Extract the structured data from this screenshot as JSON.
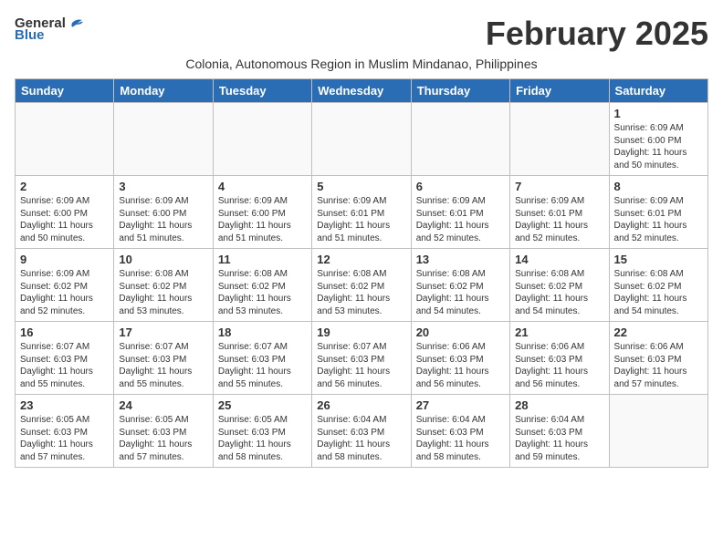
{
  "logo": {
    "general": "General",
    "blue": "Blue"
  },
  "title": "February 2025",
  "subtitle": "Colonia, Autonomous Region in Muslim Mindanao, Philippines",
  "weekdays": [
    "Sunday",
    "Monday",
    "Tuesday",
    "Wednesday",
    "Thursday",
    "Friday",
    "Saturday"
  ],
  "weeks": [
    [
      {
        "day": "",
        "info": ""
      },
      {
        "day": "",
        "info": ""
      },
      {
        "day": "",
        "info": ""
      },
      {
        "day": "",
        "info": ""
      },
      {
        "day": "",
        "info": ""
      },
      {
        "day": "",
        "info": ""
      },
      {
        "day": "1",
        "info": "Sunrise: 6:09 AM\nSunset: 6:00 PM\nDaylight: 11 hours\nand 50 minutes."
      }
    ],
    [
      {
        "day": "2",
        "info": "Sunrise: 6:09 AM\nSunset: 6:00 PM\nDaylight: 11 hours\nand 50 minutes."
      },
      {
        "day": "3",
        "info": "Sunrise: 6:09 AM\nSunset: 6:00 PM\nDaylight: 11 hours\nand 51 minutes."
      },
      {
        "day": "4",
        "info": "Sunrise: 6:09 AM\nSunset: 6:00 PM\nDaylight: 11 hours\nand 51 minutes."
      },
      {
        "day": "5",
        "info": "Sunrise: 6:09 AM\nSunset: 6:01 PM\nDaylight: 11 hours\nand 51 minutes."
      },
      {
        "day": "6",
        "info": "Sunrise: 6:09 AM\nSunset: 6:01 PM\nDaylight: 11 hours\nand 52 minutes."
      },
      {
        "day": "7",
        "info": "Sunrise: 6:09 AM\nSunset: 6:01 PM\nDaylight: 11 hours\nand 52 minutes."
      },
      {
        "day": "8",
        "info": "Sunrise: 6:09 AM\nSunset: 6:01 PM\nDaylight: 11 hours\nand 52 minutes."
      }
    ],
    [
      {
        "day": "9",
        "info": "Sunrise: 6:09 AM\nSunset: 6:02 PM\nDaylight: 11 hours\nand 52 minutes."
      },
      {
        "day": "10",
        "info": "Sunrise: 6:08 AM\nSunset: 6:02 PM\nDaylight: 11 hours\nand 53 minutes."
      },
      {
        "day": "11",
        "info": "Sunrise: 6:08 AM\nSunset: 6:02 PM\nDaylight: 11 hours\nand 53 minutes."
      },
      {
        "day": "12",
        "info": "Sunrise: 6:08 AM\nSunset: 6:02 PM\nDaylight: 11 hours\nand 53 minutes."
      },
      {
        "day": "13",
        "info": "Sunrise: 6:08 AM\nSunset: 6:02 PM\nDaylight: 11 hours\nand 54 minutes."
      },
      {
        "day": "14",
        "info": "Sunrise: 6:08 AM\nSunset: 6:02 PM\nDaylight: 11 hours\nand 54 minutes."
      },
      {
        "day": "15",
        "info": "Sunrise: 6:08 AM\nSunset: 6:02 PM\nDaylight: 11 hours\nand 54 minutes."
      }
    ],
    [
      {
        "day": "16",
        "info": "Sunrise: 6:07 AM\nSunset: 6:03 PM\nDaylight: 11 hours\nand 55 minutes."
      },
      {
        "day": "17",
        "info": "Sunrise: 6:07 AM\nSunset: 6:03 PM\nDaylight: 11 hours\nand 55 minutes."
      },
      {
        "day": "18",
        "info": "Sunrise: 6:07 AM\nSunset: 6:03 PM\nDaylight: 11 hours\nand 55 minutes."
      },
      {
        "day": "19",
        "info": "Sunrise: 6:07 AM\nSunset: 6:03 PM\nDaylight: 11 hours\nand 56 minutes."
      },
      {
        "day": "20",
        "info": "Sunrise: 6:06 AM\nSunset: 6:03 PM\nDaylight: 11 hours\nand 56 minutes."
      },
      {
        "day": "21",
        "info": "Sunrise: 6:06 AM\nSunset: 6:03 PM\nDaylight: 11 hours\nand 56 minutes."
      },
      {
        "day": "22",
        "info": "Sunrise: 6:06 AM\nSunset: 6:03 PM\nDaylight: 11 hours\nand 57 minutes."
      }
    ],
    [
      {
        "day": "23",
        "info": "Sunrise: 6:05 AM\nSunset: 6:03 PM\nDaylight: 11 hours\nand 57 minutes."
      },
      {
        "day": "24",
        "info": "Sunrise: 6:05 AM\nSunset: 6:03 PM\nDaylight: 11 hours\nand 57 minutes."
      },
      {
        "day": "25",
        "info": "Sunrise: 6:05 AM\nSunset: 6:03 PM\nDaylight: 11 hours\nand 58 minutes."
      },
      {
        "day": "26",
        "info": "Sunrise: 6:04 AM\nSunset: 6:03 PM\nDaylight: 11 hours\nand 58 minutes."
      },
      {
        "day": "27",
        "info": "Sunrise: 6:04 AM\nSunset: 6:03 PM\nDaylight: 11 hours\nand 58 minutes."
      },
      {
        "day": "28",
        "info": "Sunrise: 6:04 AM\nSunset: 6:03 PM\nDaylight: 11 hours\nand 59 minutes."
      },
      {
        "day": "",
        "info": ""
      }
    ]
  ]
}
